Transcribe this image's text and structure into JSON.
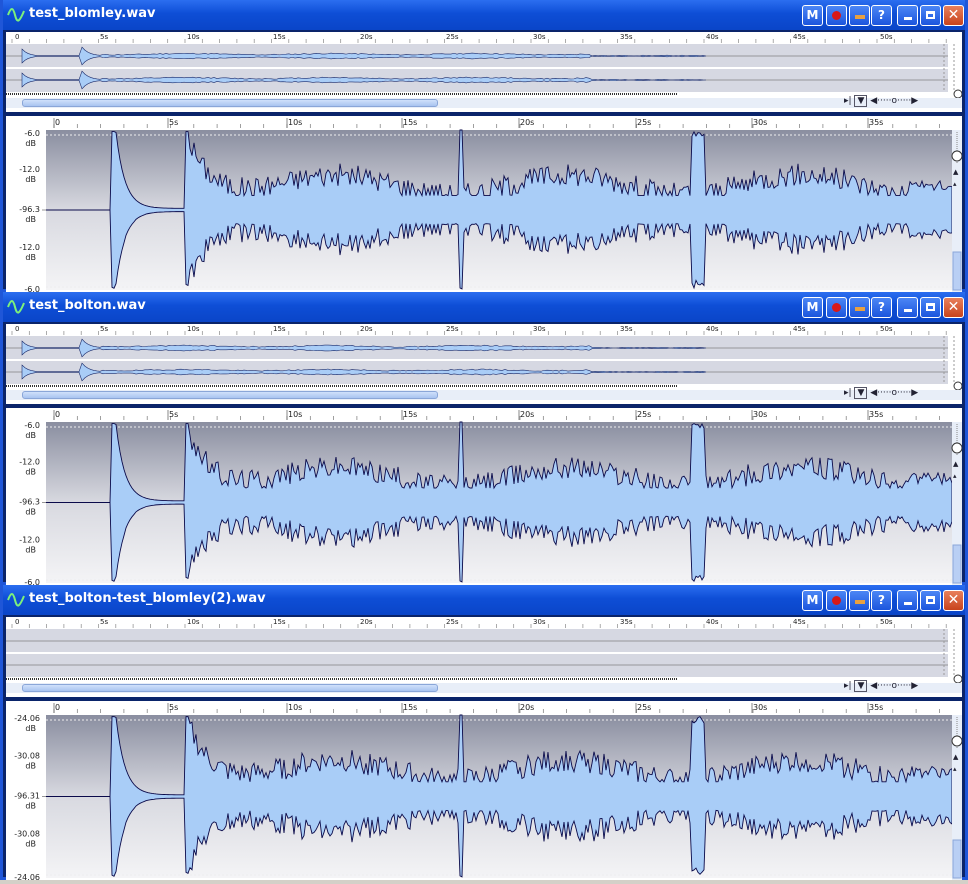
{
  "windows": [
    {
      "title": "test_blomley.wav",
      "ruler_labels": [
        "0",
        "5s",
        "10s",
        "15s",
        "20s",
        "25s",
        "30s",
        "35s"
      ],
      "overview_labels": [
        "0",
        "5s",
        "10s",
        "15s",
        "20s",
        "25s",
        "30s",
        "35s",
        "40s",
        "45s",
        "50s"
      ],
      "db_top": "-6.0",
      "db_mid": "-96.3",
      "db_upper": "-12.0",
      "db_lower": "-12.0",
      "db_bottom": "-6.0",
      "unit": "dB",
      "overview_empty": false
    },
    {
      "title": "test_bolton.wav",
      "ruler_labels": [
        "0",
        "5s",
        "10s",
        "15s",
        "20s",
        "25s",
        "30s",
        "35s"
      ],
      "overview_labels": [
        "0",
        "5s",
        "10s",
        "15s",
        "20s",
        "25s",
        "30s",
        "35s",
        "40s",
        "45s",
        "50s"
      ],
      "db_top": "-6.0",
      "db_mid": "-96.3",
      "db_upper": "-12.0",
      "db_lower": "-12.0",
      "db_bottom": "-6.0",
      "unit": "dB",
      "overview_empty": false
    },
    {
      "title": "test_bolton-test_blomley(2).wav",
      "ruler_labels": [
        "0",
        "5s",
        "10s",
        "15s",
        "20s",
        "25s",
        "30s",
        "35s"
      ],
      "overview_labels": [
        "0",
        "5s",
        "10s",
        "15s",
        "20s",
        "25s",
        "30s",
        "35s",
        "40s",
        "45s",
        "50s"
      ],
      "db_top": "-24.06",
      "db_mid": "-96.31",
      "db_upper": "-30.08",
      "db_lower": "-30.08",
      "db_bottom": "-24.06",
      "unit": "dB",
      "overview_empty": true
    }
  ],
  "title_buttons": {
    "m_label": "M",
    "help_label": "?",
    "icons": [
      "m-icon",
      "record-icon",
      "dash-icon",
      "help-icon",
      "minimize-icon",
      "maximize-icon",
      "close-icon"
    ]
  },
  "colors": {
    "title_bar": "#0e4ed6",
    "waveform_fill": "#a9cdf7",
    "waveform_stroke": "#0a0a4a",
    "panel_bg_top": "#8c90a0"
  }
}
